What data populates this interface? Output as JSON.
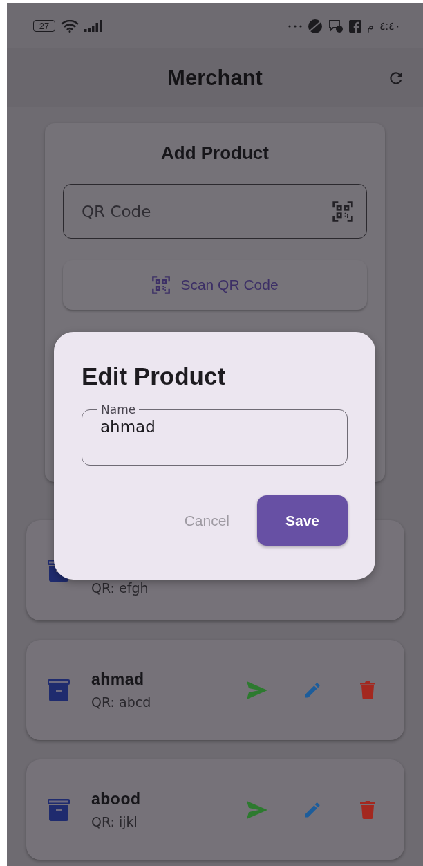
{
  "status_bar": {
    "battery": "27",
    "period": "م",
    "time": "٤:٤٠"
  },
  "app_bar": {
    "title": "Merchant"
  },
  "add_product": {
    "title": "Add Product",
    "qr_field": {
      "placeholder": "QR Code"
    },
    "scan_button": "Scan QR Code"
  },
  "products": [
    {
      "qr": "QR: efgh"
    },
    {
      "name": "ahmad",
      "qr": "QR: abcd"
    },
    {
      "name": "abood",
      "qr": "QR: ijkl"
    }
  ],
  "dialog": {
    "title": "Edit Product",
    "field": {
      "label": "Name",
      "value": "ahmad"
    },
    "buttons": [
      {
        "label": "Cancel",
        "kind": "text"
      },
      {
        "label": "Save",
        "kind": "filled"
      }
    ]
  }
}
